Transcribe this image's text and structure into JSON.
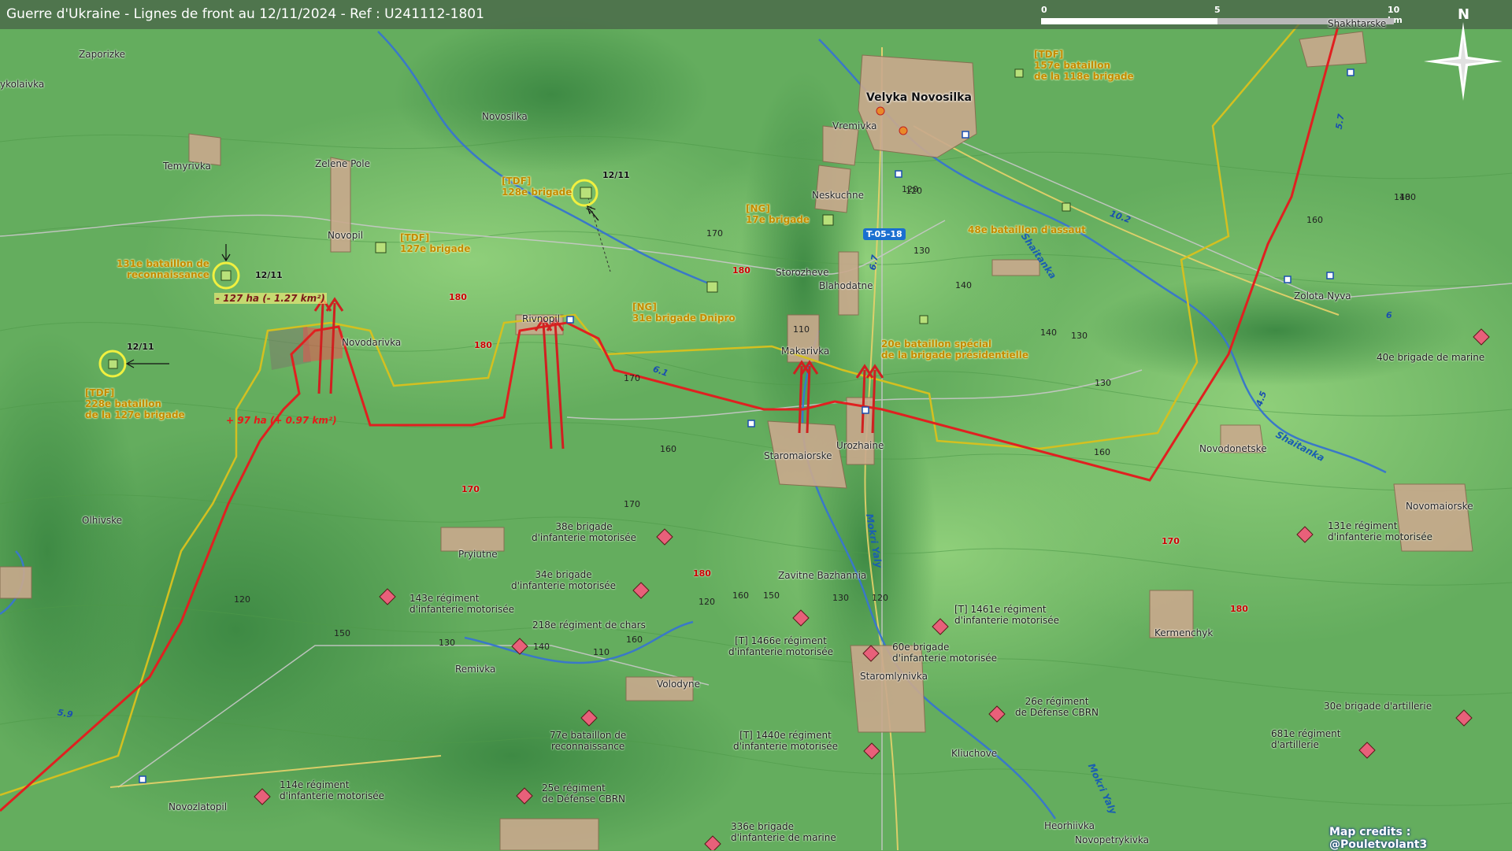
{
  "title": "Guerre d'Ukraine - Lignes de front au 12/11/2024 - Ref : U241112-1801",
  "scale_bar": {
    "labels": [
      "0",
      "5",
      "10 km"
    ]
  },
  "north_label": "N",
  "credits": "Map credits : @Pouletvolant3",
  "colors": {
    "frontline": "#e02020",
    "ukraine_line": "#d4c020",
    "ru_unit": "#e8607a",
    "ua_unit": "#b8e07a",
    "terrain": "#5fa85a"
  },
  "towns": [
    {
      "name": "Zaporizke"
    },
    {
      "name": "ykolaivka"
    },
    {
      "name": "Temyrivka"
    },
    {
      "name": "Novosilka"
    },
    {
      "name": "Zelene Pole"
    },
    {
      "name": "Novopil"
    },
    {
      "name": "Novodarivka"
    },
    {
      "name": "Rivnopil"
    },
    {
      "name": "Vremivka"
    },
    {
      "name": "Neskuchne"
    },
    {
      "name": "Storozheve"
    },
    {
      "name": "Blahodatne"
    },
    {
      "name": "Makarivka"
    },
    {
      "name": "Staromaiorske"
    },
    {
      "name": "Urozhaine"
    },
    {
      "name": "Zolota Nyva"
    },
    {
      "name": "Shakhtarske"
    },
    {
      "name": "Novodonetske"
    },
    {
      "name": "Novomaiorske"
    },
    {
      "name": "Olhivske"
    },
    {
      "name": "Pryiutne"
    },
    {
      "name": "Zavitne Bazhannia"
    },
    {
      "name": "Remivka"
    },
    {
      "name": "Volodyne"
    },
    {
      "name": "Staromlynivka"
    },
    {
      "name": "Kermenchyk"
    },
    {
      "name": "Kliuchove"
    },
    {
      "name": "Novozlatopil"
    },
    {
      "name": "Heorhiivka"
    },
    {
      "name": "Novopetrykivka"
    }
  ],
  "big_town": "Velyka Novosilka",
  "rivers": [
    "Shaitanka",
    "Shaitanka",
    "Mokri Yaly",
    "Mokri Yaly"
  ],
  "road_tag": "T-05-18",
  "road_numbers": [
    "5.7",
    "10.2",
    "6",
    "4.5",
    "6.7",
    "6.1",
    "5.9"
  ],
  "elevations_red": [
    "180",
    "180",
    "180",
    "170",
    "180",
    "170",
    "180"
  ],
  "elevations": [
    "170",
    "120",
    "130",
    "140",
    "110",
    "140",
    "130",
    "130",
    "120",
    "160",
    "180",
    "170",
    "170",
    "160",
    "160",
    "150",
    "130",
    "140",
    "120",
    "150",
    "160",
    "130",
    "110",
    "120",
    "140",
    "120",
    "160"
  ],
  "ua_units": [
    {
      "tag": "[TDF]",
      "lines": [
        "157e bataillon",
        "de la 118e brigade"
      ]
    },
    {
      "tag": "[TDF]",
      "lines": [
        "128e brigade"
      ]
    },
    {
      "tag": "[NG]",
      "lines": [
        "17e brigade"
      ]
    },
    {
      "tag": "",
      "lines": [
        "48e bataillon d'assaut"
      ]
    },
    {
      "tag": "[TDF]",
      "lines": [
        "127e brigade"
      ]
    },
    {
      "tag": "",
      "lines": [
        "131e bataillon de",
        "reconnaissance"
      ]
    },
    {
      "tag": "[NG]",
      "lines": [
        "31e brigade Dnipro"
      ]
    },
    {
      "tag": "",
      "lines": [
        "20e bataillon spécial",
        "de la brigade présidentielle"
      ]
    },
    {
      "tag": "[TDF]",
      "lines": [
        "228e bataillon",
        "de la 127e brigade"
      ]
    }
  ],
  "ru_units": [
    {
      "lines": [
        "40e brigade de marine"
      ]
    },
    {
      "lines": [
        "38e brigade",
        "d'infanterie motorisée"
      ]
    },
    {
      "lines": [
        "34e brigade",
        "d'infanterie motorisée"
      ]
    },
    {
      "lines": [
        "143e régiment",
        "d'infanterie motorisée"
      ]
    },
    {
      "lines": [
        "218e régiment de chars"
      ]
    },
    {
      "lines": [
        "[T] 1466e régiment",
        "d'infanterie motorisée"
      ]
    },
    {
      "lines": [
        "[T] 1461e régiment",
        "d'infanterie motorisée"
      ]
    },
    {
      "lines": [
        "60e brigade",
        "d'infanterie motorisée"
      ]
    },
    {
      "lines": [
        "131e régiment",
        "d'infanterie motorisée"
      ]
    },
    {
      "lines": [
        "77e bataillon de",
        "reconnaissance"
      ]
    },
    {
      "lines": [
        "[T] 1440e régiment",
        "d'infanterie motorisée"
      ]
    },
    {
      "lines": [
        "26e régiment",
        "de Défense CBRN"
      ]
    },
    {
      "lines": [
        "30e brigade d'artillerie"
      ]
    },
    {
      "lines": [
        "681e régiment",
        "d'artillerie"
      ]
    },
    {
      "lines": [
        "114e régiment",
        "d'infanterie motorisée"
      ]
    },
    {
      "lines": [
        "25e régiment",
        "de Défense CBRN"
      ]
    },
    {
      "lines": [
        "336e brigade",
        "d'infanterie de marine"
      ]
    }
  ],
  "dates": [
    "12/11",
    "12/11",
    "12/11"
  ],
  "area_changes": [
    "- 127 ha (- 1.27 km²)",
    "+ 97 ha (+ 0.97 km²)"
  ]
}
